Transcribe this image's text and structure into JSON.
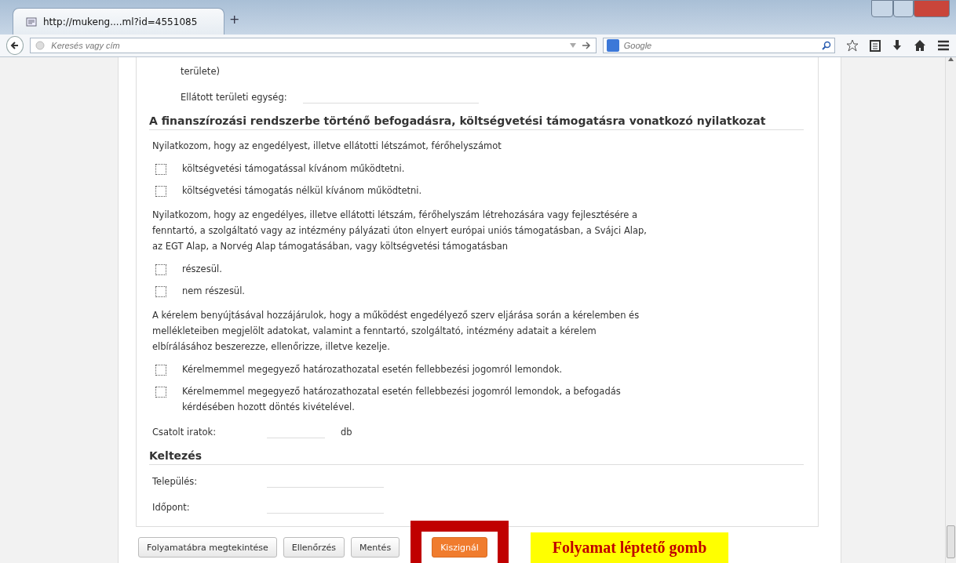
{
  "browser": {
    "tab_title": "http://mukeng....ml?id=4551085",
    "new_tab": "+",
    "address_placeholder": "Keresés vagy cím",
    "search_placeholder": "Google"
  },
  "form": [
    {
      "kind": "text",
      "indent": true,
      "text": "területe)"
    },
    {
      "kind": "field",
      "indent": true,
      "label": "Ellátott területi egység:"
    },
    {
      "kind": "heading",
      "text": "A finanszírozási rendszerbe történő befogadásra, költségvetési támogatásra vonatkozó nyilatkozat"
    },
    {
      "kind": "text",
      "indent": false,
      "text": "Nyilatkozom, hogy az engedélyest, illetve ellátotti létszámot, férőhelyszámot"
    },
    {
      "kind": "checkbox",
      "checked": false,
      "text": "költségvetési támogatással kívánom működtetni."
    },
    {
      "kind": "checkbox",
      "checked": false,
      "text": "költségvetési támogatás nélkül kívánom működtetni."
    },
    {
      "kind": "text",
      "indent": false,
      "text": "Nyilatkozom, hogy az engedélyes, illetve ellátotti létszám, férőhelyszám létrehozására vagy fejlesztésére a fenntartó, a szolgáltató vagy az intézmény pályázati úton elnyert európai uniós támogatásban, a Svájci Alap, az EGT Alap, a Norvég Alap támogatásában, vagy költségvetési támogatásban"
    },
    {
      "kind": "checkbox",
      "checked": false,
      "text": "részesül."
    },
    {
      "kind": "checkbox",
      "checked": false,
      "text": "nem részesül."
    },
    {
      "kind": "text",
      "indent": false,
      "text": "A kérelem benyújtásával hozzájárulok, hogy a működést engedélyező szerv eljárása során a kérelemben és mellékleteiben megjelölt adatokat, valamint a fenntartó, szolgáltató, intézmény adatait a kérelem elbírálásához beszerezze, ellenőrizze, illetve kezelje."
    },
    {
      "kind": "checkbox",
      "checked": false,
      "text": "Kérelmemmel megegyező határozathozatal esetén fellebbezési jogomról lemondok."
    },
    {
      "kind": "checkbox",
      "checked": false,
      "text": "Kérelmemmel megegyező határozathozatal esetén fellebbezési jogomról lemondok, a befogadás kérdésében hozott döntés kivételével."
    },
    {
      "kind": "field",
      "indent": false,
      "label": "Csatolt iratok:",
      "unit": "db"
    },
    {
      "kind": "heading",
      "text": "Keltezés"
    },
    {
      "kind": "field",
      "indent": false,
      "label": "Település:"
    },
    {
      "kind": "field",
      "indent": false,
      "label": "Időpont:"
    }
  ],
  "buttons": [
    {
      "label": "Folyamatábra megtekintése",
      "kind": "default",
      "highlighted": false
    },
    {
      "label": "Ellenőrzés",
      "kind": "default",
      "highlighted": false
    },
    {
      "label": "Mentés",
      "kind": "default",
      "highlighted": false
    },
    {
      "label": "Kiszignál",
      "kind": "primary",
      "highlighted": true
    }
  ],
  "annotation": {
    "text": "Folyamat léptető gomb"
  }
}
